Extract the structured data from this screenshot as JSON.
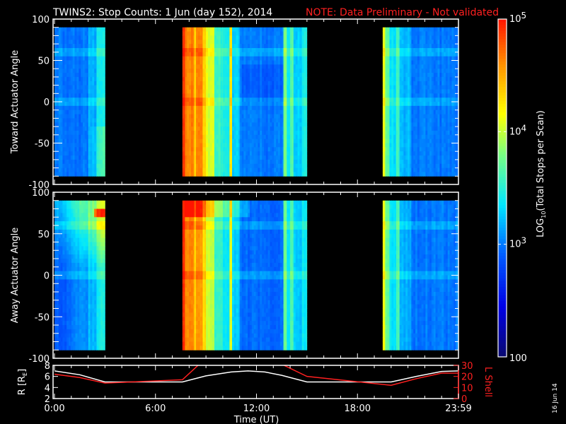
{
  "title": "TWINS2: Stop Counts:  1 Jun (day 152), 2014",
  "note": "NOTE: Data Preliminary - Not validated",
  "date_stamp": "16 Jun 14",
  "colors": {
    "note": "#ff2020",
    "l_shell": "#ff2020",
    "r_line": "#ffffff",
    "axis": "#ffffff"
  },
  "chart_data": [
    {
      "type": "heatmap",
      "name": "toward",
      "ylabel": "Toward Actuator Angle",
      "ylim": [
        -100,
        100
      ],
      "yticks": [
        "100",
        "50",
        "0",
        "-50",
        "-100"
      ],
      "ytick_values": [
        100,
        50,
        0,
        -50,
        -100
      ],
      "xlim_hours": [
        0,
        24
      ],
      "data_angle_range": [
        -90,
        90
      ],
      "columns_log10": [
        [
          0.0,
          2.0,
          3.0
        ],
        [
          2.0,
          2.5,
          3.15
        ],
        [
          2.5,
          3.0,
          3.45
        ],
        [
          7.6,
          7.75,
          4.9
        ],
        [
          7.75,
          8.3,
          4.65
        ],
        [
          8.3,
          8.4,
          4.3
        ],
        [
          8.4,
          8.8,
          4.65
        ],
        [
          8.8,
          9.0,
          4.35
        ],
        [
          9.0,
          9.5,
          4.05
        ],
        [
          9.5,
          10.0,
          3.55
        ],
        [
          10.0,
          10.4,
          3.4
        ],
        [
          10.4,
          10.55,
          4.2
        ],
        [
          10.55,
          11.0,
          3.3
        ],
        [
          11.0,
          13.6,
          3.0
        ],
        [
          13.6,
          13.8,
          3.8
        ],
        [
          13.8,
          14.0,
          3.4
        ],
        [
          14.0,
          14.2,
          3.7
        ],
        [
          14.2,
          14.7,
          3.3
        ],
        [
          14.7,
          15.0,
          3.45
        ],
        [
          19.5,
          19.65,
          4.1
        ],
        [
          19.65,
          19.9,
          3.7
        ],
        [
          19.9,
          20.3,
          3.35
        ],
        [
          20.3,
          20.5,
          3.6
        ],
        [
          20.5,
          21.2,
          3.2
        ],
        [
          21.2,
          24.0,
          3.0
        ]
      ]
    },
    {
      "type": "heatmap",
      "name": "away",
      "ylabel": "Away Actuator Angle",
      "ylim": [
        -100,
        100
      ],
      "yticks": [
        "100",
        "50",
        "0",
        "-50",
        "-100"
      ],
      "ytick_values": [
        100,
        50,
        0,
        -50,
        -100
      ],
      "xlim_hours": [
        0,
        24
      ],
      "data_angle_range": [
        -90,
        90
      ],
      "columns_log10": [
        [
          0.0,
          1.0,
          2.9
        ],
        [
          1.0,
          2.0,
          3.05
        ],
        [
          2.0,
          2.5,
          3.2
        ],
        [
          2.5,
          3.0,
          3.45
        ],
        [
          7.6,
          7.75,
          4.9
        ],
        [
          7.75,
          8.3,
          4.6
        ],
        [
          8.3,
          8.4,
          4.3
        ],
        [
          8.4,
          8.8,
          4.6
        ],
        [
          8.8,
          9.0,
          4.3
        ],
        [
          9.0,
          9.5,
          4.0
        ],
        [
          9.5,
          10.0,
          3.5
        ],
        [
          10.0,
          10.4,
          3.35
        ],
        [
          10.4,
          10.55,
          4.1
        ],
        [
          10.55,
          11.0,
          3.25
        ],
        [
          11.0,
          13.6,
          2.95
        ],
        [
          13.6,
          13.8,
          3.75
        ],
        [
          13.8,
          14.0,
          3.35
        ],
        [
          14.0,
          14.2,
          3.65
        ],
        [
          14.2,
          14.7,
          3.25
        ],
        [
          14.7,
          15.0,
          3.4
        ],
        [
          19.5,
          19.65,
          4.1
        ],
        [
          19.65,
          19.9,
          3.7
        ],
        [
          19.9,
          20.3,
          3.35
        ],
        [
          20.3,
          20.5,
          3.6
        ],
        [
          20.5,
          21.2,
          3.2
        ],
        [
          21.2,
          24.0,
          3.0
        ]
      ]
    },
    {
      "type": "line",
      "name": "orbit",
      "xlabel": "Time (UT)",
      "xticks": [
        "0:00",
        "6:00",
        "12:00",
        "18:00",
        "23:59"
      ],
      "xtick_hours": [
        0,
        6,
        12,
        18,
        24
      ],
      "ylabel_left": "R [R",
      "ylabel_left_sub": "E",
      "ylabel_left_end": "]",
      "ylim_left": [
        2,
        8
      ],
      "yticks_left": [
        "8",
        "6",
        "4",
        "2"
      ],
      "ylabel_right": "L Shell",
      "ylim_right": [
        0,
        30
      ],
      "yticks_right": [
        "30",
        "20",
        "10",
        "0"
      ],
      "series": [
        {
          "name": "R",
          "axis": "left",
          "x": [
            0,
            1.5,
            3,
            7.6,
            9,
            10.5,
            11.5,
            12.5,
            13.5,
            15,
            20,
            21.5,
            23,
            24
          ],
          "y": [
            7.0,
            6.3,
            5.0,
            5.0,
            6.1,
            6.8,
            7.0,
            6.8,
            6.2,
            5.0,
            5.0,
            6.0,
            6.9,
            7.0
          ]
        },
        {
          "name": "L Shell",
          "axis": "right",
          "x": [
            0,
            1.5,
            3,
            7.6,
            8.6,
            13.5,
            15,
            20,
            21.5,
            23,
            24
          ],
          "y": [
            22,
            19,
            14,
            17,
            31,
            31,
            20,
            12,
            18,
            23,
            23
          ]
        }
      ]
    }
  ],
  "colorbar": {
    "label": "LOG",
    "label_sub": "10",
    "label_end": "(Total Stops per Scan)",
    "range_log10": [
      2,
      5
    ],
    "ticks": [
      {
        "base": "10",
        "exp": "5",
        "value": 5
      },
      {
        "base": "10",
        "exp": "4",
        "value": 4
      },
      {
        "base": "10",
        "exp": "3",
        "value": 3
      },
      {
        "base": "100",
        "exp": "",
        "value": 2
      }
    ]
  }
}
